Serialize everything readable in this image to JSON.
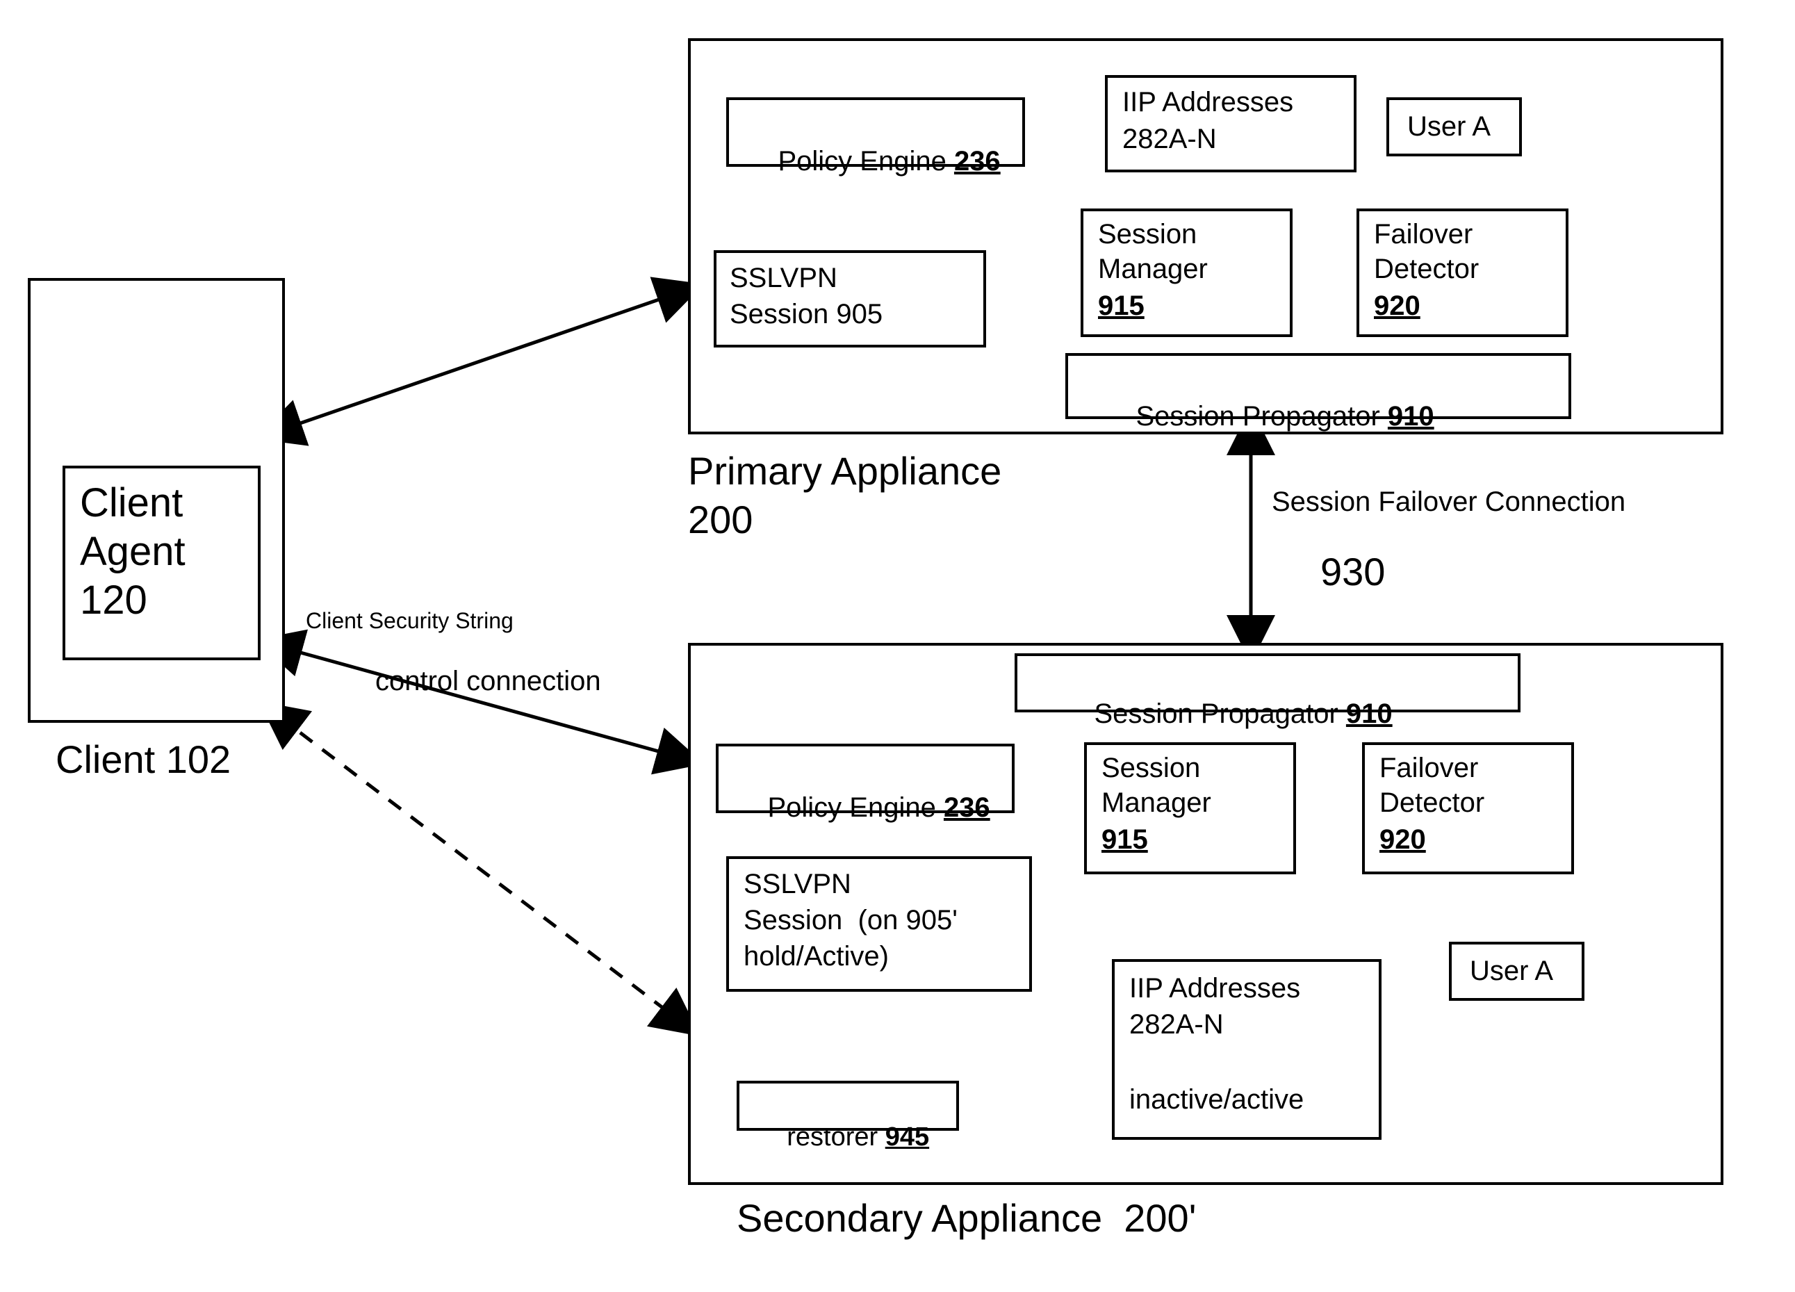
{
  "client": {
    "outer_label": "Client 102",
    "agent_l1": "Client",
    "agent_l2": "Agent",
    "agent_l3": "120"
  },
  "connections": {
    "client_security": "Client Security String",
    "control": "control connection",
    "failover_label": "Session Failover Connection",
    "failover_num": "930"
  },
  "primary": {
    "label_l1": "Primary Appliance",
    "label_l2": "200",
    "policy_engine": "Policy Engine ",
    "policy_engine_ref": "236",
    "iip_l1": "IIP Addresses",
    "iip_l2": "282A-N",
    "usera": "User A",
    "sslvpn_l1": "SSLVPN",
    "sslvpn_l2": "Session 905",
    "session_mgr_l1": "Session",
    "session_mgr_l2": "Manager",
    "session_mgr_ref": "915",
    "failover_det_l1": "Failover",
    "failover_det_l2": "Detector",
    "failover_det_ref": "920",
    "session_prop": "Session Propagator ",
    "session_prop_ref": "910"
  },
  "secondary": {
    "label": "Secondary Appliance  200'",
    "session_prop": "Session Propagator ",
    "session_prop_ref": "910",
    "policy_engine": "Policy Engine ",
    "policy_engine_ref": "236",
    "session_mgr_l1": "Session",
    "session_mgr_l2": "Manager",
    "session_mgr_ref": "915",
    "failover_det_l1": "Failover",
    "failover_det_l2": "Detector",
    "failover_det_ref": "920",
    "sslvpn_l1": "SSLVPN",
    "sslvpn_l2": "Session  (on 905'",
    "sslvpn_l3": "hold/Active)",
    "iip_l1": "IIP Addresses",
    "iip_l2": "282A-N",
    "iip_l3": "inactive/active",
    "usera": "User A",
    "restorer": "restorer ",
    "restorer_ref": "945"
  }
}
